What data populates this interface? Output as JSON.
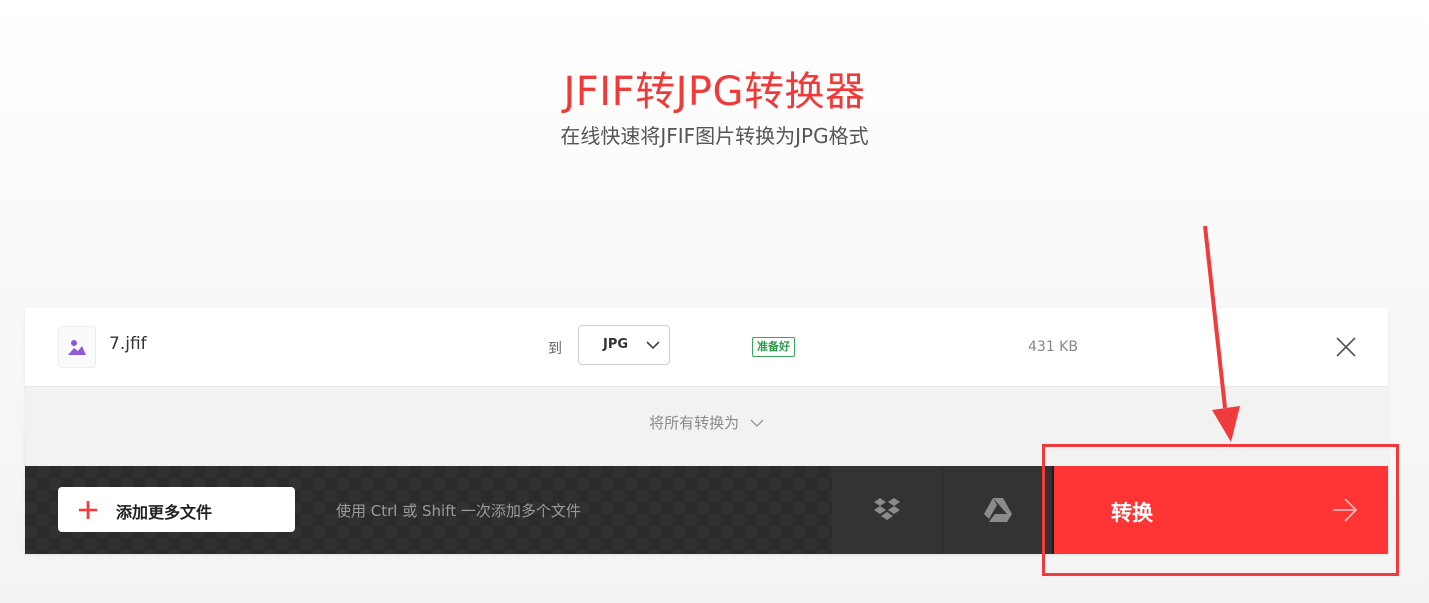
{
  "header": {
    "title": "JFIF转JPG转换器",
    "subtitle": "在线快速将JFIF图片转换为JPG格式"
  },
  "file": {
    "name": "7.jfif",
    "to_label": "到",
    "format": "JPG",
    "status": "准备好",
    "size": "431 KB"
  },
  "convert_all_label": "将所有转换为",
  "toolbar": {
    "add_more_label": "添加更多文件",
    "hint": "使用 Ctrl 或 Shift 一次添加多个文件",
    "convert_label": "转换",
    "cloud_services": [
      "dropbox-icon",
      "google-drive-icon"
    ]
  },
  "colors": {
    "accent": "#ff3535",
    "title": "#ef3a3a",
    "ready": "#2e9b4d",
    "annotation": "#ef3b3b"
  }
}
